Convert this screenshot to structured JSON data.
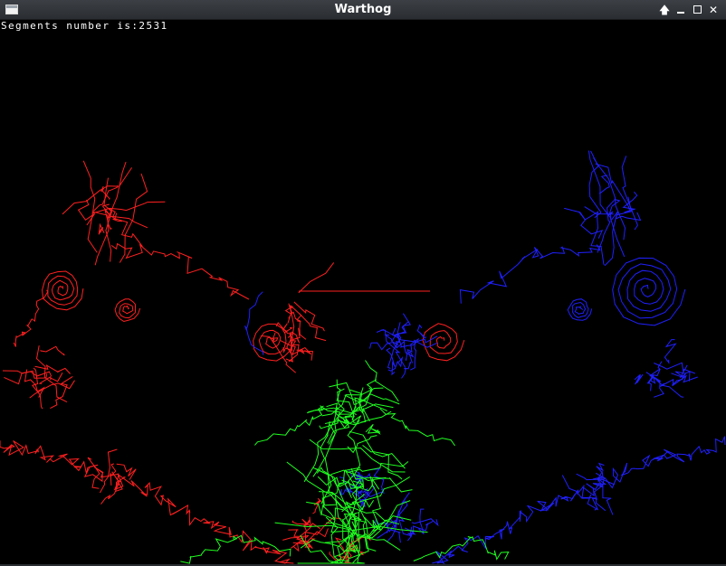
{
  "window": {
    "title": "Warthog",
    "controls": {
      "up_icon": "up-arrow-icon",
      "minimize_icon": "minimize-icon",
      "maximize_icon": "maximize-icon",
      "close_icon": "close-icon"
    }
  },
  "canvas": {
    "background": "#000000",
    "status_text": "Segments number is:2531",
    "colors": {
      "red": "#ff2020",
      "blue": "#2020ff",
      "green": "#20ff20"
    }
  }
}
